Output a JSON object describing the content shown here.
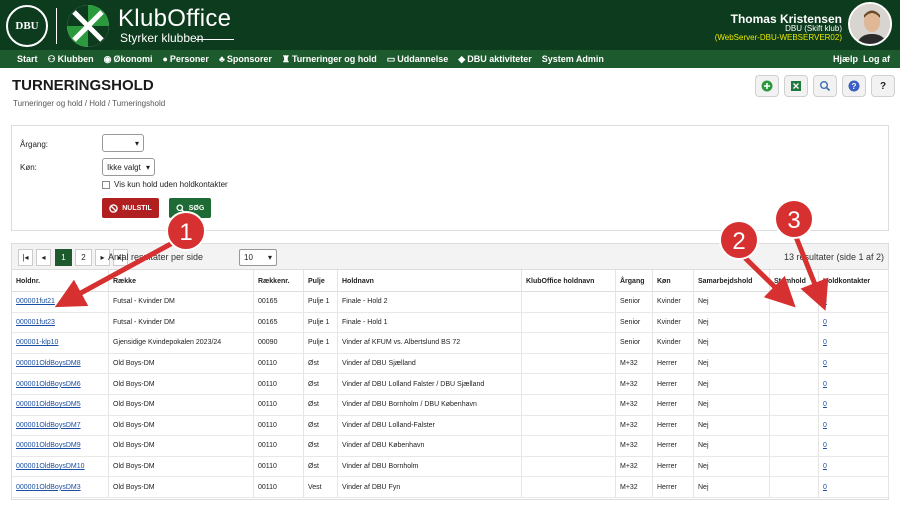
{
  "header": {
    "dbu_logo_text": "DBU",
    "brand": "KlubOffice",
    "tagline": "Styrker klubben",
    "user_name": "Thomas Kristensen",
    "user_club": "DBU (Skift klub)",
    "server": "(WebServer-DBU-WEBSERVER02)"
  },
  "nav": {
    "items": [
      "Start",
      "Klubben",
      "Økonomi",
      "Personer",
      "Sponsorer",
      "Turneringer og hold",
      "Uddannelse",
      "DBU aktiviteter",
      "System Admin"
    ],
    "help": "Hjælp",
    "logout": "Log af"
  },
  "page": {
    "title": "TURNERINGSHOLD",
    "breadcrumb": "Turneringer og hold / Hold / Turneringshold"
  },
  "filters": {
    "argang_label": "Årgang:",
    "argang_value": "",
    "kon_label": "Køn:",
    "kon_value": "Ikke valgt",
    "checkbox_label": "Vis kun hold uden holdkontakter",
    "reset_label": "NULSTIL",
    "search_label": "SØG"
  },
  "pager": {
    "first": "|◂",
    "prev": "◂",
    "pages": [
      "1",
      "2"
    ],
    "current_page": "1",
    "next": "▸",
    "last": "▸|",
    "per_page_label": "Antal resultater per side",
    "per_page_value": "10",
    "total": "13 resultater (side 1 af 2)"
  },
  "table": {
    "columns": [
      "Holdnr.",
      "Række",
      "Rækkenr.",
      "Pulje",
      "Holdnavn",
      "KlubOffice holdnavn",
      "Årgang",
      "Køn",
      "Samarbejdshold",
      "Stamhold",
      "Holdkontakter"
    ],
    "rows": [
      [
        "000001fut21",
        "Futsal - Kvinder DM",
        "00165",
        "Pulje 1",
        "Finale - Hold 2",
        "",
        "Senior",
        "Kvinder",
        "Nej",
        "",
        "0"
      ],
      [
        "000001fut23",
        "Futsal - Kvinder DM",
        "00165",
        "Pulje 1",
        "Finale - Hold 1",
        "",
        "Senior",
        "Kvinder",
        "Nej",
        "",
        "0"
      ],
      [
        "000001-klp10",
        "Gjensidige Kvindepokalen 2023/24",
        "00090",
        "Pulje 1",
        "Vinder af KFUM vs. Albertslund BS 72",
        "",
        "Senior",
        "Kvinder",
        "Nej",
        "",
        "0"
      ],
      [
        "000001OldBoysDM8",
        "Old Boys-DM",
        "00110",
        "Øst",
        "Vinder af DBU Sjælland",
        "",
        "M+32",
        "Herrer",
        "Nej",
        "",
        "0"
      ],
      [
        "000001OldBoysDM6",
        "Old Boys-DM",
        "00110",
        "Øst",
        "Vinder af DBU Lolland Falster / DBU Sjælland",
        "",
        "M+32",
        "Herrer",
        "Nej",
        "",
        "0"
      ],
      [
        "000001OldBoysDM5",
        "Old Boys-DM",
        "00110",
        "Øst",
        "Vinder af DBU Bornholm / DBU København",
        "",
        "M+32",
        "Herrer",
        "Nej",
        "",
        "0"
      ],
      [
        "000001OldBoysDM7",
        "Old Boys-DM",
        "00110",
        "Øst",
        "Vinder af DBU Lolland-Falster",
        "",
        "M+32",
        "Herrer",
        "Nej",
        "",
        "0"
      ],
      [
        "000001OldBoysDM9",
        "Old Boys-DM",
        "00110",
        "Øst",
        "Vinder af DBU København",
        "",
        "M+32",
        "Herrer",
        "Nej",
        "",
        "0"
      ],
      [
        "000001OldBoysDM10",
        "Old Boys-DM",
        "00110",
        "Øst",
        "Vinder af DBU Bornholm",
        "",
        "M+32",
        "Herrer",
        "Nej",
        "",
        "0"
      ],
      [
        "000001OldBoysDM3",
        "Old Boys-DM",
        "00110",
        "Vest",
        "Vinder af DBU Fyn",
        "",
        "M+32",
        "Herrer",
        "Nej",
        "",
        "0"
      ]
    ]
  },
  "annotations": [
    "1",
    "2",
    "3"
  ],
  "colors": {
    "header_bg": "#0d3b1e",
    "nav_bg": "#1d5a2d",
    "annotation_red": "#d63030",
    "link_blue": "#1a4ea0",
    "reset_red": "#b02020",
    "search_green": "#1f6b35"
  }
}
